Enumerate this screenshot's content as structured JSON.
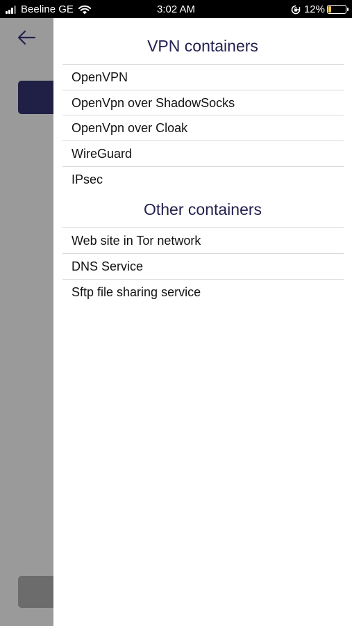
{
  "status_bar": {
    "carrier": "Beeline GE",
    "time": "3:02 AM",
    "battery": "12%",
    "battery_level": 0.12,
    "icons": [
      "signal-icon",
      "wifi-icon",
      "rotation-lock-icon",
      "battery-icon"
    ]
  },
  "background": {
    "back_icon": "arrow-left-icon"
  },
  "colors": {
    "heading": "#23214f",
    "dim_overlay": "#9a9a9a",
    "dark_block": "#201f45",
    "battery_fill": "#f2c94c"
  },
  "drawer": {
    "vpn_title": "VPN containers",
    "vpn_items": [
      {
        "label": "OpenVPN"
      },
      {
        "label": "OpenVpn over ShadowSocks"
      },
      {
        "label": "OpenVpn over Cloak"
      },
      {
        "label": "WireGuard"
      },
      {
        "label": "IPsec"
      }
    ],
    "other_title": "Other containers",
    "other_items": [
      {
        "label": "Web site in Tor network"
      },
      {
        "label": "DNS Service"
      },
      {
        "label": "Sftp file sharing service"
      }
    ]
  }
}
